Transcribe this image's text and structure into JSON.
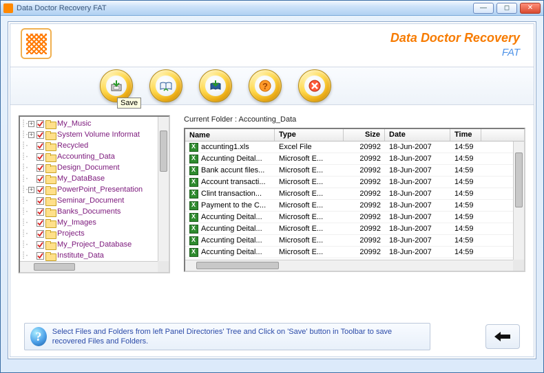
{
  "titlebar": {
    "title": "Data Doctor Recovery FAT"
  },
  "brand": {
    "line1": "Data Doctor Recovery",
    "line2": "FAT"
  },
  "toolbar": {
    "buttons": [
      {
        "name": "save-button",
        "tooltip": "Save"
      },
      {
        "name": "open-log-button"
      },
      {
        "name": "load-button"
      },
      {
        "name": "help-button"
      },
      {
        "name": "stop-button"
      }
    ]
  },
  "tree": {
    "items": [
      {
        "label": "My_Music",
        "expandable": true
      },
      {
        "label": "System Volume Informat",
        "expandable": true
      },
      {
        "label": "Recycled",
        "expandable": false
      },
      {
        "label": "Accounting_Data",
        "expandable": false
      },
      {
        "label": "Design_Document",
        "expandable": false
      },
      {
        "label": "My_DataBase",
        "expandable": false
      },
      {
        "label": "PowerPoint_Presentation",
        "expandable": true
      },
      {
        "label": "Seminar_Document",
        "expandable": false
      },
      {
        "label": "Banks_Documents",
        "expandable": false
      },
      {
        "label": "My_Images",
        "expandable": false
      },
      {
        "label": "Projects",
        "expandable": false
      },
      {
        "label": "My_Project_Database",
        "expandable": false
      },
      {
        "label": "Institute_Data",
        "expandable": false
      }
    ]
  },
  "filelist": {
    "current_label": "Current Folder   :   Accounting_Data",
    "columns": {
      "name": "Name",
      "type": "Type",
      "size": "Size",
      "date": "Date",
      "time": "Time"
    },
    "rows": [
      {
        "name": "accunting1.xls",
        "type": "Excel File",
        "size": "20992",
        "date": "18-Jun-2007",
        "time": "14:59"
      },
      {
        "name": "Accunting Deital...",
        "type": "Microsoft E...",
        "size": "20992",
        "date": "18-Jun-2007",
        "time": "14:59"
      },
      {
        "name": "Bank accunt files...",
        "type": "Microsoft E...",
        "size": "20992",
        "date": "18-Jun-2007",
        "time": "14:59"
      },
      {
        "name": "Account transacti...",
        "type": "Microsoft E...",
        "size": "20992",
        "date": "18-Jun-2007",
        "time": "14:59"
      },
      {
        "name": "Clint transaction...",
        "type": "Microsoft E...",
        "size": "20992",
        "date": "18-Jun-2007",
        "time": "14:59"
      },
      {
        "name": "Payment to the C...",
        "type": "Microsoft E...",
        "size": "20992",
        "date": "18-Jun-2007",
        "time": "14:59"
      },
      {
        "name": "Accunting Deital...",
        "type": "Microsoft E...",
        "size": "20992",
        "date": "18-Jun-2007",
        "time": "14:59"
      },
      {
        "name": "Accunting Deital...",
        "type": "Microsoft E...",
        "size": "20992",
        "date": "18-Jun-2007",
        "time": "14:59"
      },
      {
        "name": "Accunting Deital...",
        "type": "Microsoft E...",
        "size": "20992",
        "date": "18-Jun-2007",
        "time": "14:59"
      },
      {
        "name": "Accunting Deital...",
        "type": "Microsoft E...",
        "size": "20992",
        "date": "18-Jun-2007",
        "time": "14:59"
      }
    ]
  },
  "hint": {
    "text": "Select Files and Folders from left Panel Directories' Tree and Click on 'Save' button in Toolbar to save recovered Files and Folders."
  },
  "colors": {
    "accent_orange": "#f77b00",
    "accent_blue": "#5094e8",
    "tree_text": "#7b177b"
  }
}
